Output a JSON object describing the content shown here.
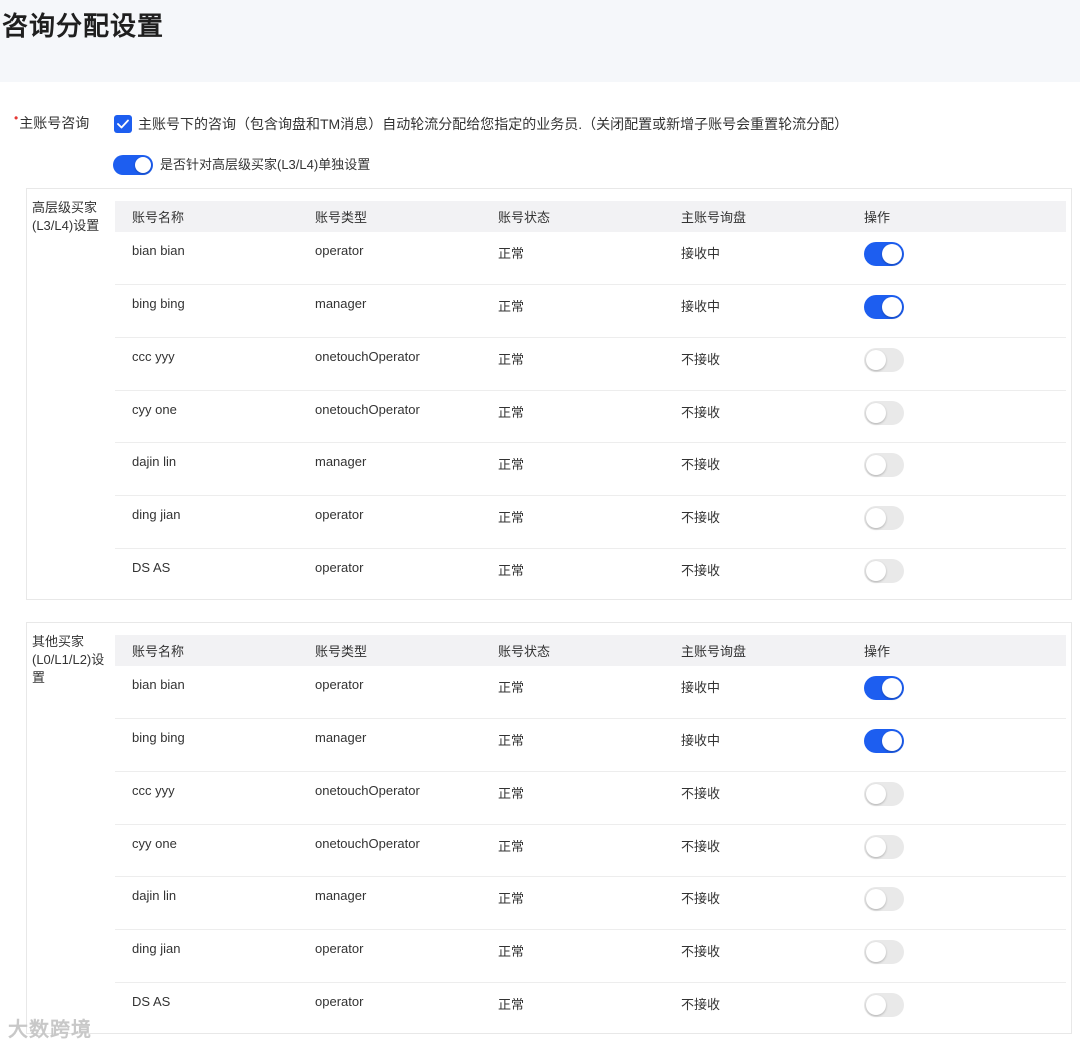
{
  "page": {
    "title": "咨询分配设置"
  },
  "form": {
    "label": "主账号咨询",
    "required_mark": "•",
    "checkbox_checked": true,
    "checkbox_text": "主账号下的咨询（包含询盘和TM消息）自动轮流分配给您指定的业务员.（关闭配置或新增子账号会重置轮流分配）",
    "switch_on": true,
    "switch_text": "是否针对高层级买家(L3/L4)单独设置"
  },
  "columns": [
    "账号名称",
    "账号类型",
    "账号状态",
    "主账号询盘",
    "操作"
  ],
  "sections": [
    {
      "label": "高层级买家(L3/L4)设置",
      "rows": [
        {
          "name": "bian bian",
          "type": "operator",
          "status": "正常",
          "inquiry": "接收中",
          "enabled": true
        },
        {
          "name": "bing bing",
          "type": "manager",
          "status": "正常",
          "inquiry": "接收中",
          "enabled": true
        },
        {
          "name": "ccc yyy",
          "type": "onetouchOperator",
          "status": "正常",
          "inquiry": "不接收",
          "enabled": false
        },
        {
          "name": "cyy one",
          "type": "onetouchOperator",
          "status": "正常",
          "inquiry": "不接收",
          "enabled": false
        },
        {
          "name": "dajin lin",
          "type": "manager",
          "status": "正常",
          "inquiry": "不接收",
          "enabled": false
        },
        {
          "name": "ding jian",
          "type": "operator",
          "status": "正常",
          "inquiry": "不接收",
          "enabled": false
        },
        {
          "name": "DS AS",
          "type": "operator",
          "status": "正常",
          "inquiry": "不接收",
          "enabled": false
        }
      ]
    },
    {
      "label": "其他买家(L0/L1/L2)设置",
      "rows": [
        {
          "name": "bian bian",
          "type": "operator",
          "status": "正常",
          "inquiry": "接收中",
          "enabled": true
        },
        {
          "name": "bing bing",
          "type": "manager",
          "status": "正常",
          "inquiry": "接收中",
          "enabled": true
        },
        {
          "name": "ccc yyy",
          "type": "onetouchOperator",
          "status": "正常",
          "inquiry": "不接收",
          "enabled": false
        },
        {
          "name": "cyy one",
          "type": "onetouchOperator",
          "status": "正常",
          "inquiry": "不接收",
          "enabled": false
        },
        {
          "name": "dajin lin",
          "type": "manager",
          "status": "正常",
          "inquiry": "不接收",
          "enabled": false
        },
        {
          "name": "ding jian",
          "type": "operator",
          "status": "正常",
          "inquiry": "不接收",
          "enabled": false
        },
        {
          "name": "DS AS",
          "type": "operator",
          "status": "正常",
          "inquiry": "不接收",
          "enabled": false
        }
      ]
    }
  ],
  "watermark": "大数跨境",
  "colors": {
    "accent": "#1d5ef0",
    "switch_off": "#e9e9e9",
    "header_bg": "#f2f2f4",
    "required": "#e53935"
  }
}
